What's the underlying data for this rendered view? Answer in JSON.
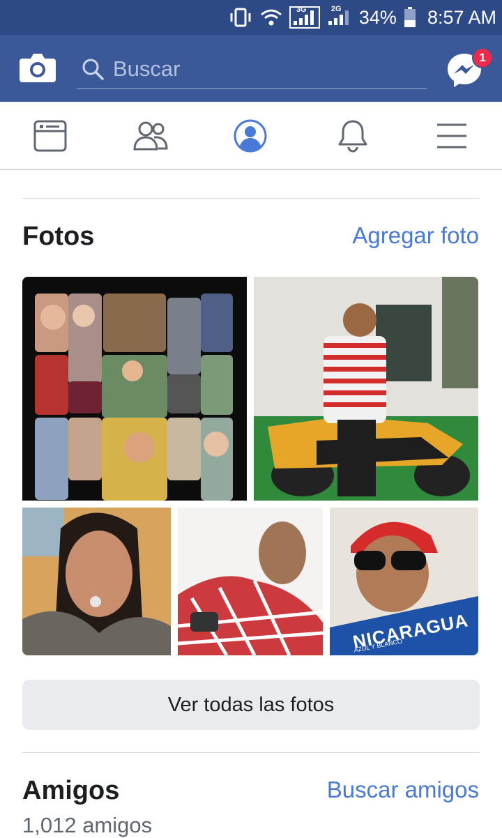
{
  "status_bar": {
    "network_1": "3G",
    "network_2": "2G",
    "battery": "34%",
    "time": "8:57 AM"
  },
  "header": {
    "search_placeholder": "Buscar",
    "messenger_badge": "1"
  },
  "tabs": [
    "news-feed",
    "friends",
    "profile",
    "notifications",
    "menu"
  ],
  "active_tab": "profile",
  "photos": {
    "title": "Fotos",
    "add_link": "Agregar foto",
    "view_all": "Ver todas las fotos",
    "photo6_caption": "NICARAGUA",
    "photo6_subcaption": "AZUL Y BLANCO"
  },
  "friends": {
    "title": "Amigos",
    "find_link": "Buscar amigos",
    "count": "1,012 amigos"
  },
  "colors": {
    "brand": "#3b5998",
    "status": "#2e4a86",
    "link": "#4a7ad8",
    "badge": "#f02849"
  }
}
